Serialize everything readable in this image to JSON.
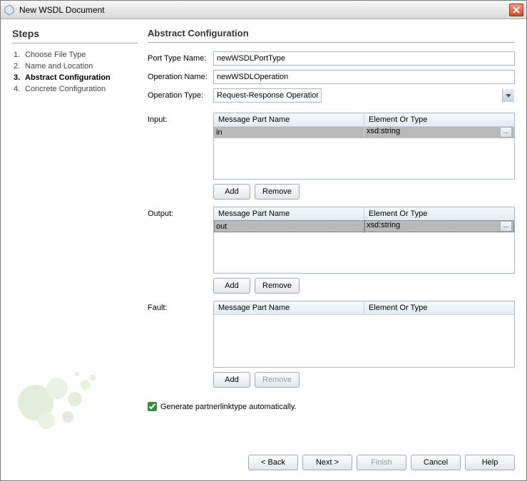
{
  "titlebar": {
    "title": "New WSDL Document"
  },
  "sidebar": {
    "title": "Steps",
    "steps": [
      {
        "num": "1.",
        "label": "Choose File Type",
        "current": false
      },
      {
        "num": "2.",
        "label": "Name and Location",
        "current": false
      },
      {
        "num": "3.",
        "label": "Abstract Configuration",
        "current": true
      },
      {
        "num": "4.",
        "label": "Concrete Configuration",
        "current": false
      }
    ]
  },
  "main": {
    "title": "Abstract Configuration",
    "port_type_label": "Port Type Name:",
    "port_type_value": "newWSDLPortType",
    "operation_name_label": "Operation Name:",
    "operation_name_value": "newWSDLOperation",
    "operation_type_label": "Operation Type:",
    "operation_type_value": "Request-Response Operation",
    "input": {
      "label": "Input:",
      "cols": [
        "Message Part Name",
        "Element Or Type"
      ],
      "rows": [
        {
          "name": "in",
          "type": "xsd:string"
        }
      ],
      "add": "Add",
      "remove": "Remove"
    },
    "output": {
      "label": "Output:",
      "cols": [
        "Message Part Name",
        "Element Or Type"
      ],
      "rows": [
        {
          "name": "out",
          "type": "xsd:string"
        }
      ],
      "add": "Add",
      "remove": "Remove"
    },
    "fault": {
      "label": "Fault:",
      "cols": [
        "Message Part Name",
        "Element Or Type"
      ],
      "add": "Add",
      "remove": "Remove"
    },
    "generate_label": "Generate partnerlinktype automatically."
  },
  "footer": {
    "back": "< Back",
    "next": "Next >",
    "finish": "Finish",
    "cancel": "Cancel",
    "help": "Help"
  }
}
